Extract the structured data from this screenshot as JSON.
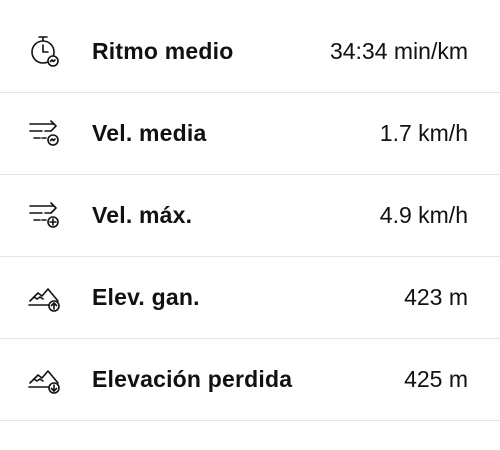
{
  "stats": [
    {
      "icon": "stopwatch-pace-icon",
      "label": "Ritmo medio",
      "value": "34:34 min/km"
    },
    {
      "icon": "speed-average-icon",
      "label": "Vel. media",
      "value": "1.7 km/h"
    },
    {
      "icon": "speed-max-icon",
      "label": "Vel. máx.",
      "value": "4.9 km/h"
    },
    {
      "icon": "elevation-gain-icon",
      "label": "Elev. gan.",
      "value": "423 m"
    },
    {
      "icon": "elevation-loss-icon",
      "label": "Elevación perdida",
      "value": "425 m"
    }
  ]
}
